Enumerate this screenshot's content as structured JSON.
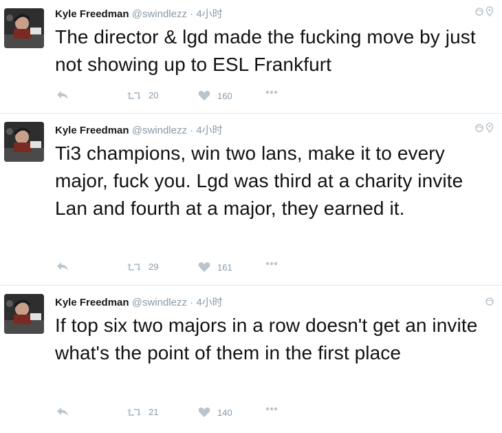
{
  "tweets": [
    {
      "name": "Kyle Freedman",
      "handle": "@swindlezz",
      "time": "· 4小时",
      "text": "The director & lgd made the fucking move by just not showing up to ESL Frankfurt",
      "retweets": "20",
      "likes": "160",
      "show_pin": true
    },
    {
      "name": "Kyle Freedman",
      "handle": "@swindlezz",
      "time": "· 4小时",
      "text": "Ti3 champions, win two lans, make it to every major, fuck you. Lgd was third at a charity invite Lan and fourth at a major, they earned it.",
      "retweets": "29",
      "likes": "161",
      "show_pin": true
    },
    {
      "name": "Kyle Freedman",
      "handle": "@swindlezz",
      "time": "· 4小时",
      "text": "If top six two majors in a row doesn't get an invite what's the point of them in the first place",
      "retweets": "21",
      "likes": "140",
      "show_pin": false
    }
  ],
  "icons": {
    "reply": "reply-arrow-icon",
    "retweet": "retweet-icon",
    "like": "heart-icon",
    "more": "more-dots-icon",
    "globe": "globe-icon",
    "location": "location-pin-icon"
  },
  "colors": {
    "icon_gray": "#b9c4cc",
    "text_gray": "#8899a6",
    "divider": "#e1e8ed"
  }
}
